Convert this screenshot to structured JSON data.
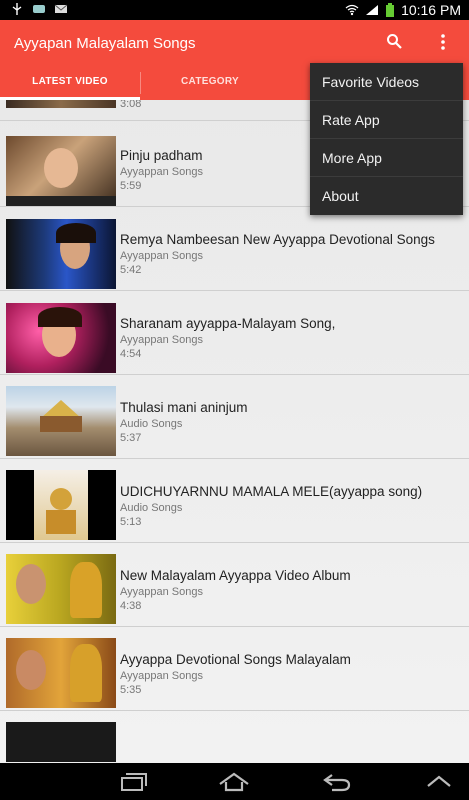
{
  "status_bar": {
    "time": "10:16 PM",
    "icons": [
      "usb-icon",
      "notification-icon",
      "mail-icon",
      "wifi-icon",
      "signal-icon",
      "battery-icon"
    ]
  },
  "app_bar": {
    "title": "Ayyapan Malayalam Songs",
    "color": "#f44b3d",
    "tabs": [
      {
        "label": "LATEST VIDEO",
        "active": true
      },
      {
        "label": "CATEGORY",
        "active": false
      }
    ]
  },
  "overflow_menu": {
    "items": [
      "Favorite Videos",
      "Rate App",
      "More App",
      "About"
    ]
  },
  "videos": [
    {
      "title": "",
      "category": "",
      "duration": "3:08"
    },
    {
      "title": "Pinju padham",
      "category": "Ayyappan Songs",
      "duration": "5:59"
    },
    {
      "title": "Remya Nambeesan New Ayyappa Devotional Songs",
      "category": "Ayyappan Songs",
      "duration": "5:42"
    },
    {
      "title": "Sharanam ayyappa-Malayam Song,",
      "category": "Ayyappan Songs",
      "duration": "4:54"
    },
    {
      "title": "Thulasi mani aninjum",
      "category": "Audio Songs",
      "duration": "5:37"
    },
    {
      "title": "UDICHUYARNNU MAMALA MELE(ayyappa song)",
      "category": "Audio Songs",
      "duration": "5:13"
    },
    {
      "title": "New Malayalam Ayyappa Video Album",
      "category": "Ayyappan Songs",
      "duration": "4:38"
    },
    {
      "title": "Ayyappa Devotional Songs Malayalam",
      "category": "Ayyappan Songs",
      "duration": "5:35"
    }
  ],
  "nav_bar": {
    "buttons": [
      "recent-apps-icon",
      "home-icon",
      "back-icon",
      "menu-up-icon"
    ]
  }
}
